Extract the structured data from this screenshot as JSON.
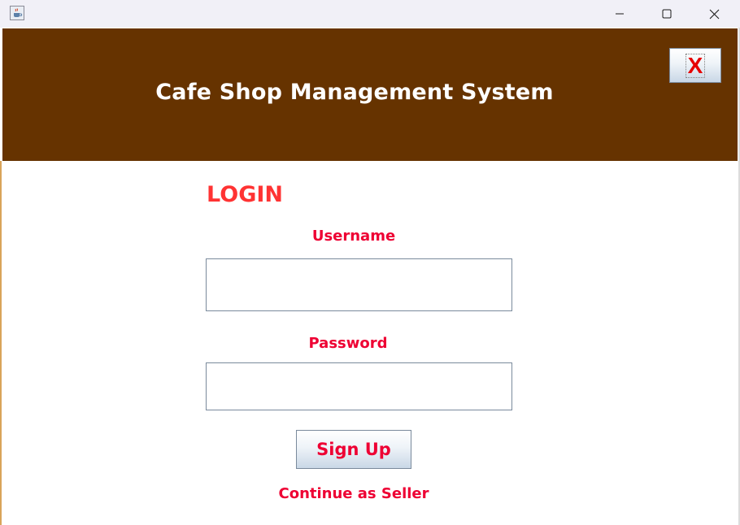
{
  "window": {
    "title_icon": "java-coffee-cup-icon",
    "controls": {
      "minimize_icon": "minimize-icon",
      "maximize_icon": "maximize-icon",
      "close_icon": "close-icon"
    }
  },
  "header": {
    "title": "Cafe Shop Management System",
    "exit_label": "X",
    "background_color": "#663300"
  },
  "login": {
    "heading": "LOGIN",
    "username_label": "Username",
    "username_value": "",
    "password_label": "Password",
    "password_value": "",
    "signup_label": "Sign Up",
    "continue_label": "Continue as Seller"
  },
  "colors": {
    "heading": "#ff3333",
    "labels": "#ee0033",
    "exit_x": "#e60000"
  }
}
